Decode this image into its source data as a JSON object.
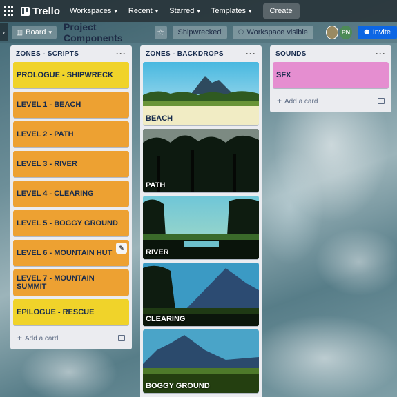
{
  "nav": {
    "brand": "Trello",
    "workspaces": "Workspaces",
    "recent": "Recent",
    "starred": "Starred",
    "templates": "Templates",
    "create": "Create"
  },
  "board": {
    "view": "Board",
    "title": "Project Components",
    "workspace_chip": "Shipwrecked",
    "visibility": "Workspace visible",
    "member_initials": "PN",
    "invite": "Invite"
  },
  "lists": [
    {
      "title": "ZONES - SCRIPTS",
      "cards": [
        {
          "label": "PROLOGUE - SHIPWRECK",
          "color": "#f0d32a"
        },
        {
          "label": "LEVEL 1 - BEACH",
          "color": "#eda132"
        },
        {
          "label": "LEVEL 2 - PATH",
          "color": "#eda132"
        },
        {
          "label": "LEVEL 3 - RIVER",
          "color": "#eda132"
        },
        {
          "label": "LEVEL 4 - CLEARING",
          "color": "#eda132"
        },
        {
          "label": "LEVEL 5 - BOGGY GROUND",
          "color": "#eda132"
        },
        {
          "label": "LEVEL 6 - MOUNTAIN HUT",
          "color": "#eda132"
        },
        {
          "label": "LEVEL 7 - MOUNTAIN SUMMIT",
          "color": "#eda132"
        },
        {
          "label": "EPILOGUE - RESCUE",
          "color": "#f0d32a"
        }
      ],
      "add_card": "Add a card"
    },
    {
      "title": "ZONES - BACKDROPS",
      "cards": [
        {
          "label": "BEACH"
        },
        {
          "label": "PATH"
        },
        {
          "label": "RIVER"
        },
        {
          "label": "CLEARING"
        },
        {
          "label": "BOGGY GROUND"
        }
      ]
    },
    {
      "title": "SOUNDS",
      "cards": [
        {
          "label": "SFX",
          "color": "#e58ed0"
        }
      ],
      "add_card": "Add a card"
    }
  ],
  "colors": {
    "yellow_label": "#f0d32a",
    "orange_label": "#eda132",
    "pink_label": "#e58ed0",
    "invite_button": "#0c66e4"
  }
}
